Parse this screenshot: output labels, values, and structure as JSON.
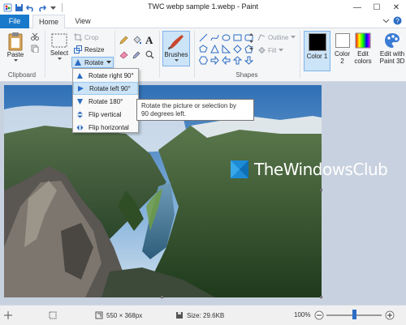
{
  "window": {
    "title": "TWC webp sample 1.webp - Paint",
    "minimize": "—",
    "maximize": "☐",
    "close": "✕"
  },
  "tabs": {
    "file": "File",
    "home": "Home",
    "view": "View"
  },
  "ribbon": {
    "clipboard": {
      "label": "Clipboard",
      "paste": "Paste"
    },
    "image": {
      "select": "Select",
      "crop": "Crop",
      "resize": "Resize",
      "rotate": "Rotate"
    },
    "tools": {},
    "brushes": {
      "label": "Brushes"
    },
    "shapes": {
      "label": "Shapes",
      "outline": "Outline",
      "fill": "Fill"
    },
    "colors": {
      "color1": "Color 1",
      "color2": "Color 2",
      "edit_colors": "Edit colors",
      "paint3d": "Edit with Paint 3D",
      "color1_value": "#000000",
      "color2_value": "#ffffff"
    }
  },
  "rotate_menu": {
    "items": [
      {
        "label": "Rotate right 90°"
      },
      {
        "label": "Rotate left 90°"
      },
      {
        "label": "Rotate 180°"
      },
      {
        "label": "Flip vertical"
      },
      {
        "label": "Flip horizontal"
      }
    ]
  },
  "tooltip": {
    "line1": "Rotate the picture or selection by",
    "line2": "90 degrees left."
  },
  "watermark": {
    "text": "TheWindowsClub"
  },
  "status": {
    "dimensions": "550 × 368px",
    "size": "Size: 29.6KB",
    "zoom": "100%",
    "zoom_fraction": 0.5
  },
  "colors": {
    "accent": "#1979ca",
    "ribbon_bg": "#f5f6f7",
    "workspace": "#c8d1df",
    "highlight": "#cce4f7"
  }
}
